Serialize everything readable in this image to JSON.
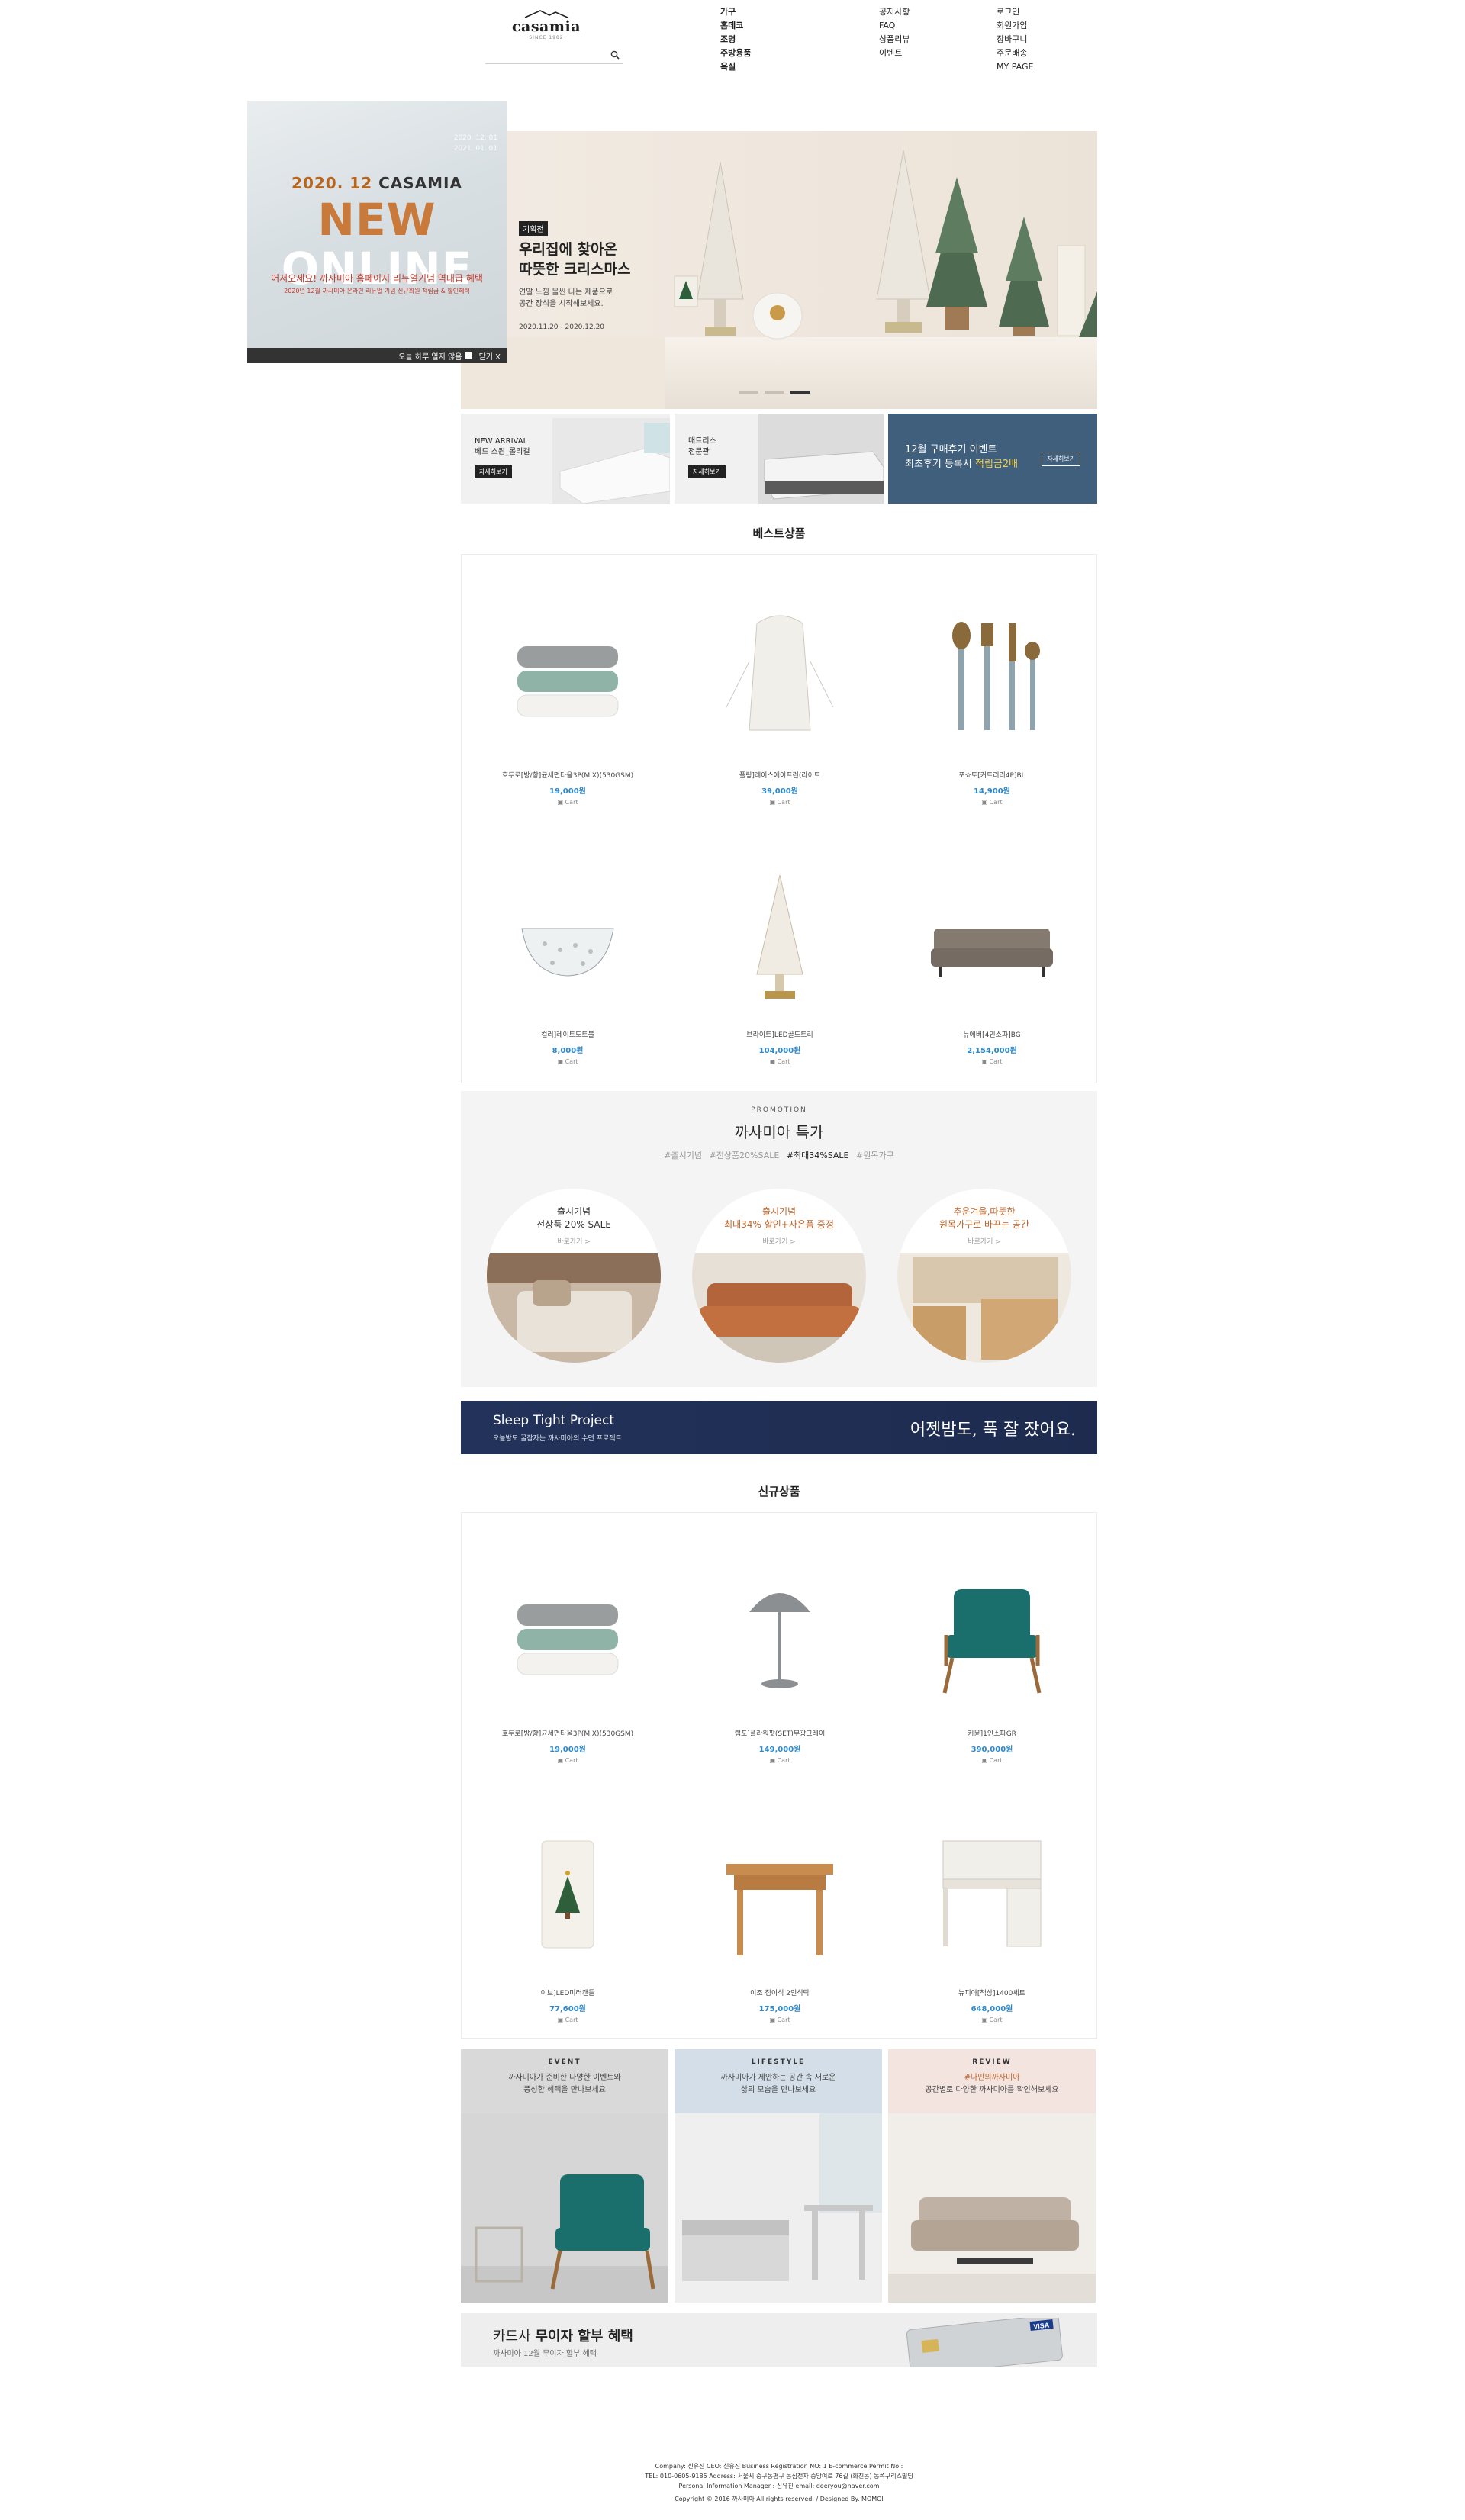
{
  "header": {
    "logo_text": "casamia",
    "logo_sub": "SINCE 1982",
    "category_menu": [
      "가구",
      "홈데코",
      "조명",
      "주방용품",
      "욕실"
    ],
    "board_menu": [
      "공지사항",
      "FAQ",
      "상품리뷰",
      "이벤트"
    ],
    "user_menu": [
      "로그인",
      "회원가입",
      "장바구니",
      "주문배송",
      "MY PAGE"
    ]
  },
  "popup": {
    "dates": [
      "2020. 12. 01",
      "2021. 01. 01"
    ],
    "year_line_a": "2020. 12 ",
    "year_line_b": "CASAMIA",
    "big_a": "NEW ",
    "big_b": "ONLINE",
    "line1": "어서오세요! 까사미아 홈페이지 리뉴얼기념 역대급 혜택",
    "line2": "2020년 12월 까사미아 온라인 리뉴얼 기념 신규회원 적립금 & 할인혜택",
    "no_today": "오늘 하루 열지 않음",
    "close": "닫기 X"
  },
  "hero": {
    "tag": "기획전",
    "title": "우리집에 찾아온\n따뜻한 크리스마스",
    "desc": "연말 느낌 물씬 나는 제품으로\n공간 장식을 시작해보세요.",
    "period": "2020.11.20 - 2020.12.20",
    "slide_active": 3,
    "slide_count": 3
  },
  "sub_banners": [
    {
      "label": "NEW ARRIVAL\n베드 스원_롤리컬",
      "button": "자세히보기"
    },
    {
      "label": "매트리스\n전문관",
      "button": "자세히보기"
    },
    {
      "label": "12월 구매후기 이벤트\n최초후기 등록시 ",
      "highlight": "적립금2배",
      "button": "자세히보기"
    }
  ],
  "best": {
    "title": "베스트상품",
    "products": [
      {
        "name": "호두로[방/향]균세면타올3P(MIX)(530GSM)",
        "price": "19,000원",
        "cart": "Cart",
        "icon": "towel-stack"
      },
      {
        "name": "플링]레이스에이프런(라이트",
        "price": "39,000원",
        "cart": "Cart",
        "icon": "apron"
      },
      {
        "name": "포쇼토[커트러리4P]BL",
        "price": "14,900원",
        "cart": "Cart",
        "icon": "cutlery"
      },
      {
        "name": "컬러]레이트도트볼",
        "price": "8,000원",
        "cart": "Cart",
        "icon": "glass-bowl"
      },
      {
        "name": "브라이트]LED골드트리",
        "price": "104,000원",
        "cart": "Cart",
        "icon": "glass-tree"
      },
      {
        "name": "뉴에버[4인소파]BG",
        "price": "2,154,000원",
        "cart": "Cart",
        "icon": "sofa"
      }
    ]
  },
  "promotion": {
    "kicker": "PROMOTION",
    "title": "까사미아 특가",
    "tags": [
      "#출시기념",
      "#전상품20%SALE",
      "#최대34%SALE",
      "#원목가구"
    ],
    "active_tag": 2,
    "circles": [
      {
        "line_a": "출시기념",
        "line_b": "전상품 20% SALE",
        "go": "바로가기 >",
        "hl": false
      },
      {
        "line_a": "출시기념",
        "line_b": "최대34% 할인+사은품 증정",
        "go": "바로가기 >",
        "hl": true
      },
      {
        "line_a": "추운겨울,따뜻한",
        "line_b": "원목가구로 바꾸는 공간",
        "go": "바로가기 >",
        "hl": true
      }
    ]
  },
  "sleep_banner": {
    "title": "Sleep Tight Project",
    "sub": "오늘밤도 꿀잠자는 까사미아의 수면 프로젝트",
    "right": "어젯밤도, 푹 잘 잤어요."
  },
  "new": {
    "title": "신규상품",
    "products": [
      {
        "name": "호두로[방/향]균세면타올3P(MIX)(530GSM)",
        "price": "19,000원",
        "cart": "Cart",
        "icon": "towel-stack"
      },
      {
        "name": "램포]플라워팟(SET)무광그레이",
        "price": "149,000원",
        "cart": "Cart",
        "icon": "lamp"
      },
      {
        "name": "커뮨]1인소파GR",
        "price": "390,000원",
        "cart": "Cart",
        "icon": "armchair"
      },
      {
        "name": "이브]LED미러캔들",
        "price": "77,600원",
        "cart": "Cart",
        "icon": "candle"
      },
      {
        "name": "이조 접이식 2인식탁",
        "price": "175,000원",
        "cart": "Cart",
        "icon": "drop-leaf-table"
      },
      {
        "name": "뉴피아[책상]1400세트",
        "price": "648,000원",
        "cart": "Cart",
        "icon": "desk"
      }
    ]
  },
  "cards": [
    {
      "kicker": "EVENT",
      "text_a": "까사미아가 준비한 다양한 이벤트와",
      "text_b": "풍성한 혜택을 만나보세요",
      "bg": "#d9d9d9"
    },
    {
      "kicker": "LIFESTYLE",
      "text_a": "까사미아가 제안하는 공간 속 새로운",
      "text_b": "삶의 모습을 만나보세요",
      "bg": "#d3dee8"
    },
    {
      "kicker": "REVIEW",
      "text_hl": "#나만의까사미아",
      "text_b": "공간별로 다양한 까사미아를 확인해보세요",
      "bg": "#f3e4e0"
    }
  ],
  "card_banner": {
    "title_a": "카드사 ",
    "title_b": "무이자 할부 혜택",
    "sub": "까사미아 12월 무이자 할부 혜택",
    "card_brand": "VISA"
  },
  "footer": {
    "line1": "Company: 신유진    CEO: 신유진    Business Registration NO: 1    E-commerce Permit No :",
    "line2": "TEL: 010-0605-9185    Address: 서울시 중구동평구 동심전자 중앙여로 76길 (화진동) 동쪽구리스빌딩",
    "line3": "Personal Information Manager : 신유진    email: deeryou@naver.com",
    "copyright": "Copyright © 2016 까사미아 All rights reserved. / Designed By. MOMOI"
  },
  "colors": {
    "price": "#2e88c9",
    "accent_orange": "#c0652a",
    "navy": "#22325a",
    "banner_blue": "#3f5f7d"
  }
}
